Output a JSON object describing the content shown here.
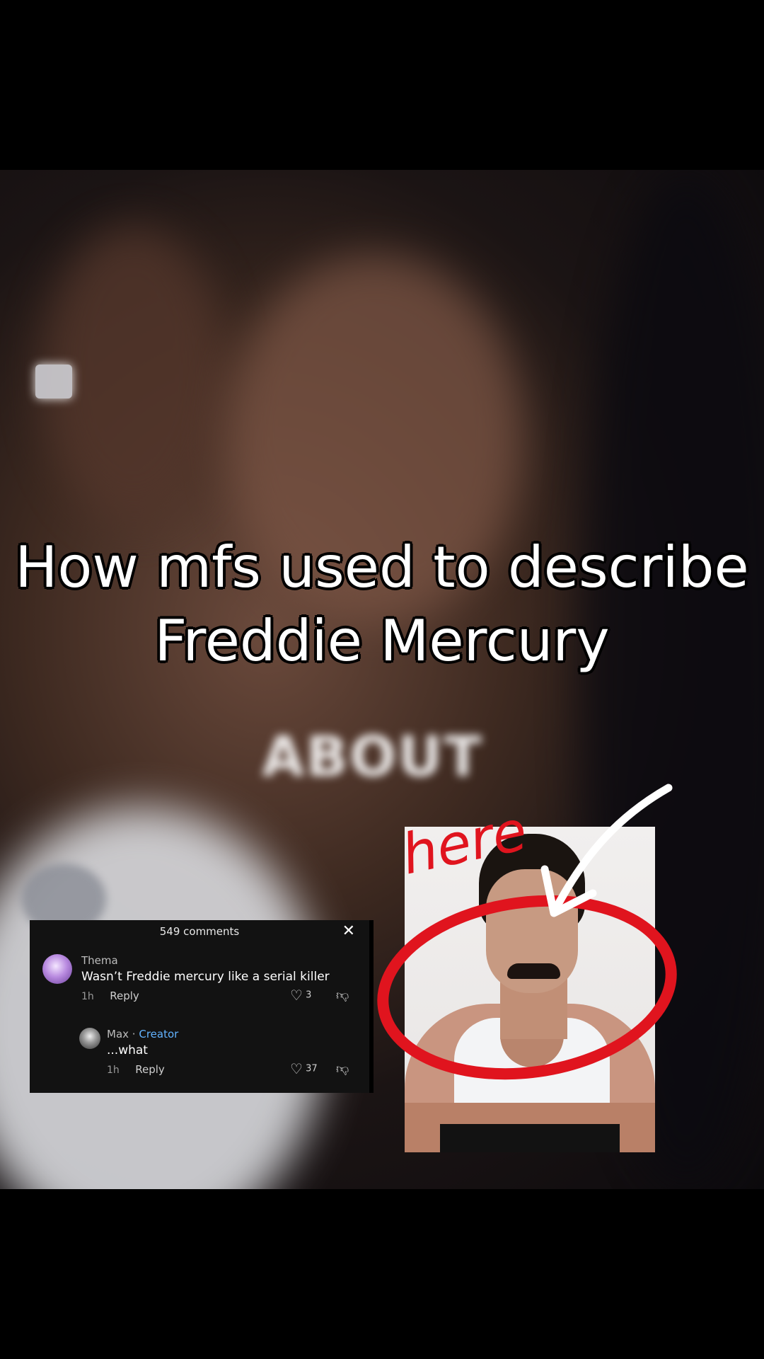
{
  "video": {
    "caption_line1": "How mfs used to describe",
    "caption_line2": "Freddie Mercury",
    "background_word": "ABOUT"
  },
  "comments_panel": {
    "header": "549 comments",
    "close_icon": "close-icon",
    "items": [
      {
        "user": "Thema",
        "text": "Wasn’t Freddie mercury like a serial killer",
        "time": "1h",
        "reply_label": "Reply",
        "likes": "3"
      },
      {
        "user": "Max",
        "role": "Creator",
        "text": "...what",
        "time": "1h",
        "reply_label": "Reply",
        "likes": "37"
      }
    ]
  },
  "photo_annotation": {
    "handwritten": "here",
    "circle_color": "#e0141e",
    "arrow_color": "#ffffff"
  }
}
